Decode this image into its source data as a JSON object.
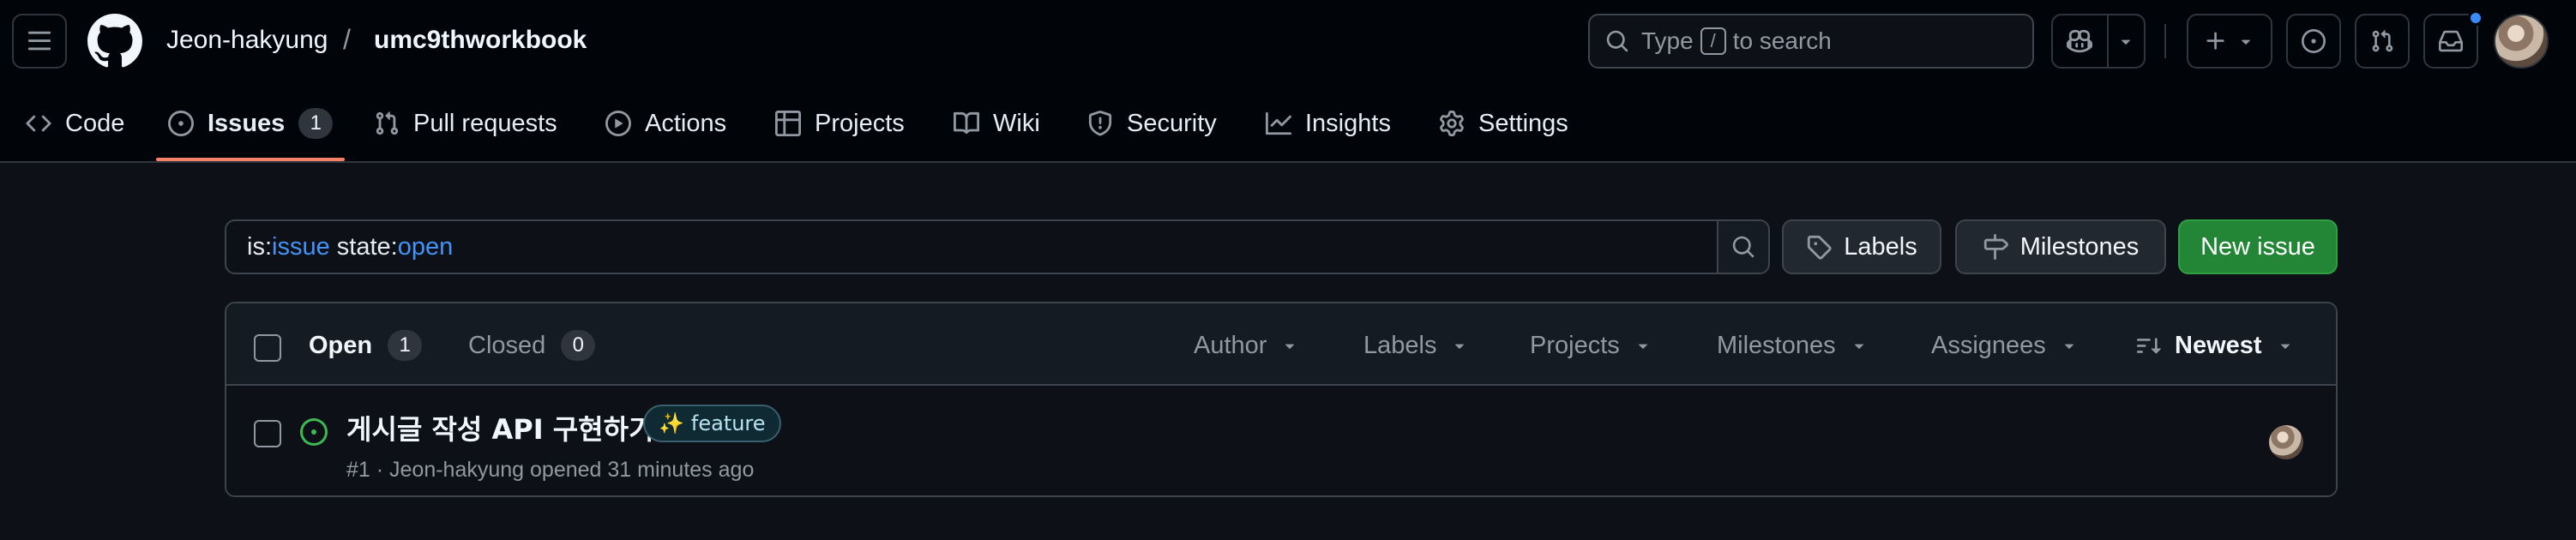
{
  "header": {
    "owner": "Jeon-hakyung",
    "separator": "/",
    "repo": "umc9thworkbook",
    "search_prefix": "Type",
    "search_key": "/",
    "search_suffix": "to search"
  },
  "nav": {
    "items": [
      {
        "label": "Code",
        "icon": "code-icon"
      },
      {
        "label": "Issues",
        "icon": "issue-opened-icon",
        "count": "1"
      },
      {
        "label": "Pull requests",
        "icon": "git-pull-request-icon"
      },
      {
        "label": "Actions",
        "icon": "play-icon"
      },
      {
        "label": "Projects",
        "icon": "table-icon"
      },
      {
        "label": "Wiki",
        "icon": "book-icon"
      },
      {
        "label": "Security",
        "icon": "shield-icon"
      },
      {
        "label": "Insights",
        "icon": "graph-icon"
      },
      {
        "label": "Settings",
        "icon": "gear-icon"
      }
    ],
    "active": "Issues"
  },
  "filter": {
    "q1_key": "is:",
    "q1_val": "issue",
    "q2_key": " state:",
    "q2_val": "open",
    "labels_label": "Labels",
    "milestones_label": "Milestones",
    "new_issue_label": "New issue"
  },
  "list_header": {
    "open_label": "Open",
    "open_count": "1",
    "closed_label": "Closed",
    "closed_count": "0",
    "filters": [
      "Author",
      "Labels",
      "Projects",
      "Milestones",
      "Assignees"
    ],
    "sort_label": "Newest"
  },
  "issues": [
    {
      "title": "게시글 작성 API 구현하기!",
      "label": {
        "emoji": "✨",
        "name": "feature",
        "color": "#0f2a33"
      },
      "meta": "#1 · Jeon-hakyung opened 31 minutes ago"
    }
  ],
  "colors": {
    "accent_underline": "#f78166",
    "new_issue_bg": "#238636",
    "open_icon": "#3fb950",
    "link_blue": "#4493f8"
  }
}
